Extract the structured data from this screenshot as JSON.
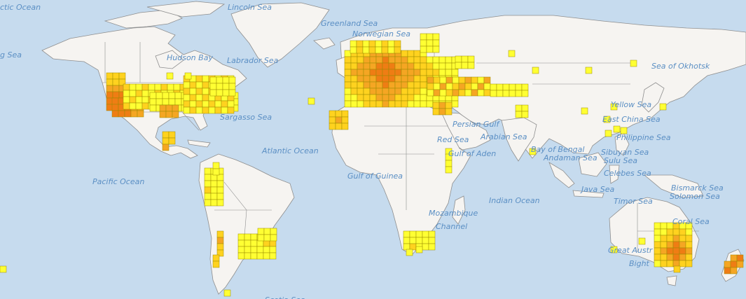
{
  "sea_labels": [
    {
      "id": "arctic-ocean",
      "text": "ctic Ocean"
    },
    {
      "id": "lincoln-sea",
      "text": "Lincoln Sea"
    },
    {
      "id": "greenland-sea",
      "text": "Greenland Sea"
    },
    {
      "id": "norwegian-sea",
      "text": "Norwegian Sea"
    },
    {
      "id": "bering-sea",
      "text": "g Sea"
    },
    {
      "id": "hudson-bay",
      "text": "Hudson Bay"
    },
    {
      "id": "labrador-sea",
      "text": "Labrador Sea"
    },
    {
      "id": "sargasso-sea",
      "text": "Sargasso Sea"
    },
    {
      "id": "atlantic-ocean",
      "text": "Atlantic Ocean"
    },
    {
      "id": "pacific-ocean",
      "text": "Pacific Ocean"
    },
    {
      "id": "gulf-of-guinea",
      "text": "Gulf of Guinea"
    },
    {
      "id": "persian-gulf",
      "text": "Persian Gulf"
    },
    {
      "id": "red-sea",
      "text": "Red Sea"
    },
    {
      "id": "arabian-sea",
      "text": "Arabian Sea"
    },
    {
      "id": "gulf-of-aden",
      "text": "Gulf of Aden"
    },
    {
      "id": "bay-of-bengal",
      "text": "Bay of Bengal"
    },
    {
      "id": "andaman-sea",
      "text": "Andaman Sea"
    },
    {
      "id": "sea-of-okhotsk",
      "text": "Sea of Okhotsk"
    },
    {
      "id": "yellow-sea",
      "text": "Yellow Sea"
    },
    {
      "id": "east-china-sea",
      "text": "East China Sea"
    },
    {
      "id": "philippine-sea",
      "text": "Philippine Sea"
    },
    {
      "id": "sibuyan-sea",
      "text": "Sibuyan Sea"
    },
    {
      "id": "sulu-sea",
      "text": "Sulu Sea"
    },
    {
      "id": "celebes-sea",
      "text": "Celebes Sea"
    },
    {
      "id": "java-sea",
      "text": "Java Sea"
    },
    {
      "id": "bismarck-sea",
      "text": "Bismarck Sea"
    },
    {
      "id": "solomon-sea",
      "text": "Solomon Sea"
    },
    {
      "id": "timor-sea",
      "text": "Timor Sea"
    },
    {
      "id": "coral-sea",
      "text": "Coral Sea"
    },
    {
      "id": "indian-ocean",
      "text": "Indian Ocean"
    },
    {
      "id": "mozambique-channel-1",
      "text": "Mozambique"
    },
    {
      "id": "mozambique-channel-2",
      "text": "Channel"
    },
    {
      "id": "great-australian-bight-1",
      "text": "Great Austr"
    },
    {
      "id": "great-australian-bight-2",
      "text": "Bight"
    },
    {
      "id": "scotia-sea",
      "text": "Scotia Sea"
    }
  ],
  "colors": {
    "ocean": "#c6dbee",
    "land": "#f6f4f1",
    "border": "#8e8e8e",
    "sea_label": "#5b8fc4",
    "density_low": "#ffff33",
    "density_mid": "#ffd21f",
    "density_high": "#f5a623",
    "density_max": "#ef7d14"
  }
}
